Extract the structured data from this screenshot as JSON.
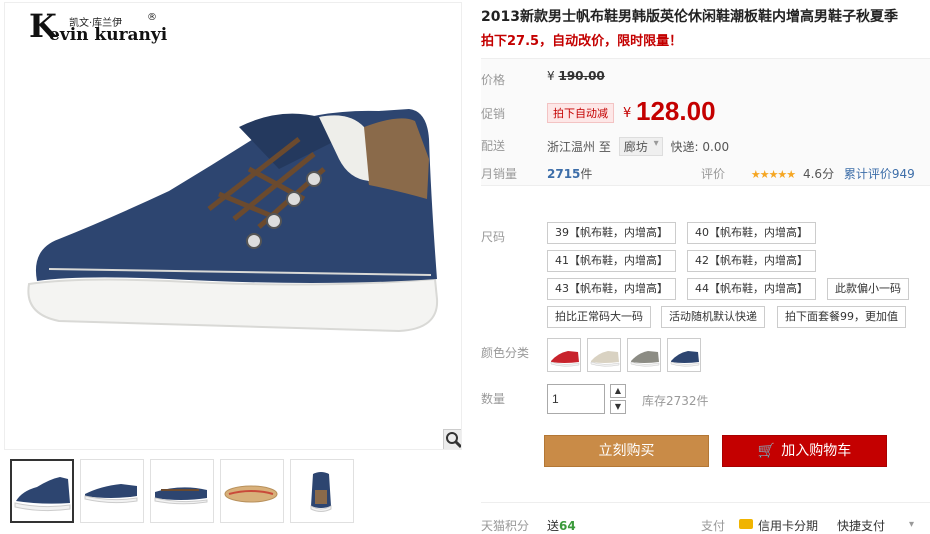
{
  "brand": {
    "letter": "K",
    "cn": "凯文·库兰伊",
    "en": "evin kuranyi",
    "reg": "®"
  },
  "product": {
    "title": "2013新款男士帆布鞋男韩版英伦休闲鞋潮板鞋内增高男鞋子秋夏季",
    "promo": "拍下27.5，自动改价，限时限量！"
  },
  "price": {
    "label_price": "价格",
    "orig_currency": "¥",
    "orig_amount": "190.00",
    "label_promo": "促销",
    "promo_tag": "拍下自动减",
    "currency": "¥",
    "amount": "128.00"
  },
  "shipping": {
    "label": "配送",
    "from": "浙江温州",
    "to_word": "至",
    "to_city": "廊坊",
    "fee": "快递: 0.00"
  },
  "sales": {
    "label": "月销量",
    "count": "2715",
    "unit": "件"
  },
  "rating": {
    "label": "评价",
    "stars": "★★★★★",
    "score": "4.6分",
    "reviews": "累计评价949"
  },
  "sizes": {
    "label": "尺码",
    "options": [
      "39【帆布鞋，内增高】",
      "40【帆布鞋，内增高】",
      "41【帆布鞋，内增高】",
      "42【帆布鞋，内增高】",
      "43【帆布鞋，内增高】",
      "44【帆布鞋，内增高】",
      "此款偏小一码",
      "拍比正常码大一码",
      "活动随机默认快递",
      "拍下面套餐99，更加值"
    ]
  },
  "colors": {
    "label": "颜色分类",
    "swatches": [
      "#c8232c",
      "#d9d2c2",
      "#8c8c84",
      "#2d4570"
    ]
  },
  "quantity": {
    "label": "数量",
    "value": "1",
    "up": "▲",
    "down": "▼",
    "stock": "库存2732件"
  },
  "buttons": {
    "buy": "立刻购买",
    "cart": "加入购物车",
    "cart_icon": "🛒"
  },
  "footer": {
    "points_label": "天猫积分",
    "points_prefix": "送",
    "points": "64",
    "pay_label": "支付",
    "card": "信用卡分期",
    "quick": "快捷支付",
    "arrow": "▾"
  },
  "colors_theme": {
    "accent_red": "#c40000",
    "buy_orange": "#c98b47",
    "shoe_blue": "#2d4570"
  }
}
